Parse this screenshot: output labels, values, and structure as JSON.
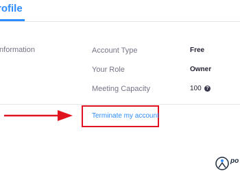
{
  "tabs": {
    "active_label": "Profile"
  },
  "section": {
    "label": "Information"
  },
  "account_rows": [
    {
      "label": "Account Type",
      "value": "Free"
    },
    {
      "label": "Your Role",
      "value": "Owner"
    },
    {
      "label": "Meeting Capacity",
      "value": "100"
    }
  ],
  "help_icon_glyph": "?",
  "terminate": {
    "label": "Terminate my account"
  },
  "watermark": {
    "text": "po"
  },
  "colors": {
    "accent": "#2D8CFF",
    "highlight": "#e0141e",
    "text": "#232333",
    "muted": "#747487"
  }
}
